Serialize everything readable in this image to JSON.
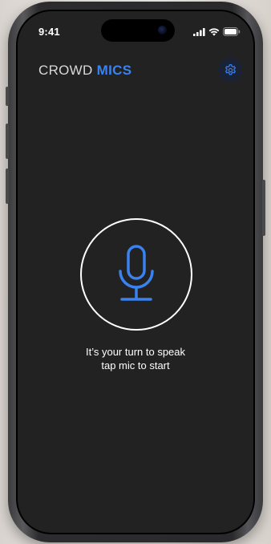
{
  "status_bar": {
    "time": "9:41",
    "signal_icon": "cellular-signal-icon",
    "wifi_icon": "wifi-icon",
    "battery_icon": "battery-icon"
  },
  "header": {
    "brand_part1": "CROWD",
    "brand_part2": "MICS",
    "settings_icon": "gear-icon"
  },
  "main": {
    "mic_icon": "microphone-icon",
    "prompt_line1": "It’s your turn to speak",
    "prompt_line2": "tap mic to start"
  },
  "colors": {
    "accent": "#3a82f0",
    "screen_background": "#222222",
    "text": "#ffffff"
  }
}
